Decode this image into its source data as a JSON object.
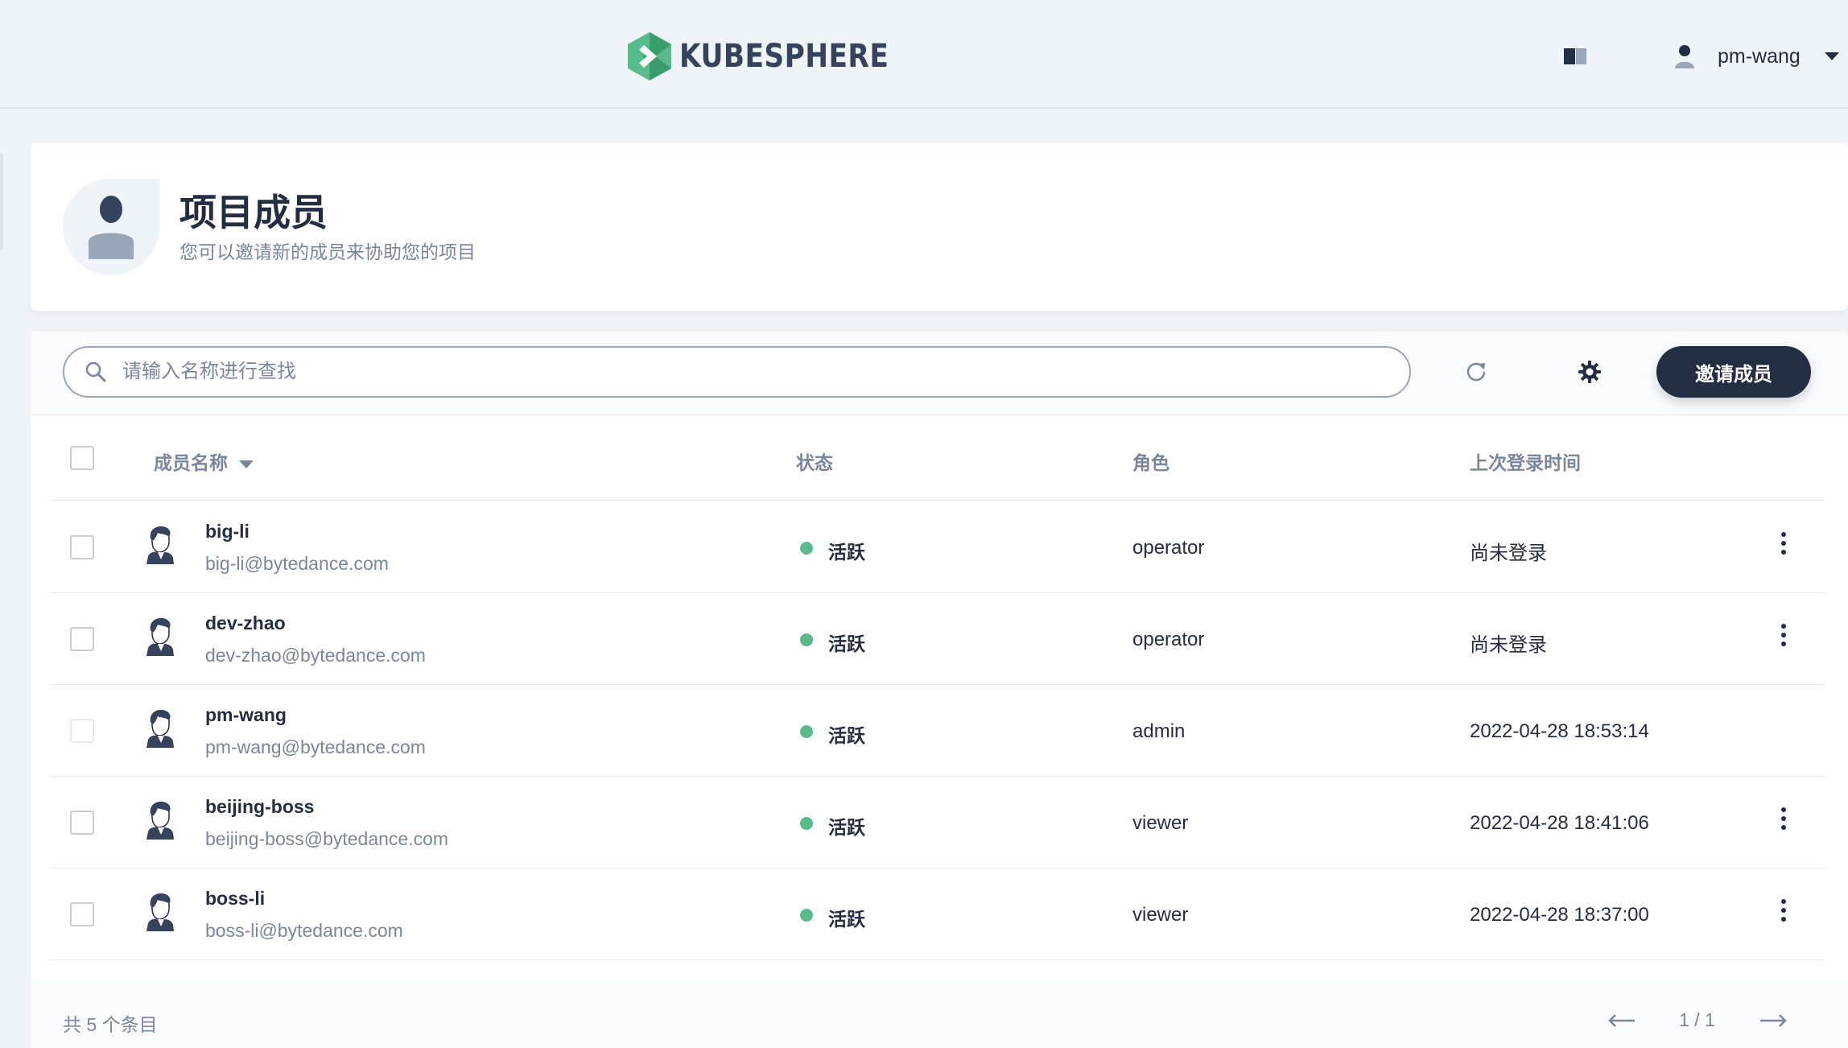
{
  "app": {
    "logo_text": "KUBESPHERE",
    "brand_color": "#55bc8a"
  },
  "topbar": {
    "doc_icon": "book-icon",
    "username": "pm-wang"
  },
  "header": {
    "title": "项目成员",
    "description": "您可以邀请新的成员来协助您的项目"
  },
  "toolbar": {
    "search_placeholder": "请输入名称进行查找",
    "invite_label": "邀请成员"
  },
  "table": {
    "columns": {
      "name": "成员名称",
      "status": "状态",
      "role": "角色",
      "last_login": "上次登录时间"
    },
    "rows": [
      {
        "name": "big-li",
        "email": "big-li@bytedance.com",
        "status": "活跃",
        "role": "operator",
        "last_login": "尚未登录",
        "selectable": true,
        "has_menu": true
      },
      {
        "name": "dev-zhao",
        "email": "dev-zhao@bytedance.com",
        "status": "活跃",
        "role": "operator",
        "last_login": "尚未登录",
        "selectable": true,
        "has_menu": true
      },
      {
        "name": "pm-wang",
        "email": "pm-wang@bytedance.com",
        "status": "活跃",
        "role": "admin",
        "last_login": "2022-04-28 18:53:14",
        "selectable": false,
        "has_menu": false
      },
      {
        "name": "beijing-boss",
        "email": "beijing-boss@bytedance.com",
        "status": "活跃",
        "role": "viewer",
        "last_login": "2022-04-28 18:41:06",
        "selectable": true,
        "has_menu": true
      },
      {
        "name": "boss-li",
        "email": "boss-li@bytedance.com",
        "status": "活跃",
        "role": "viewer",
        "last_login": "2022-04-28 18:37:00",
        "selectable": true,
        "has_menu": true
      }
    ]
  },
  "footer": {
    "total": "共 5 个条目",
    "page": "1 / 1"
  }
}
